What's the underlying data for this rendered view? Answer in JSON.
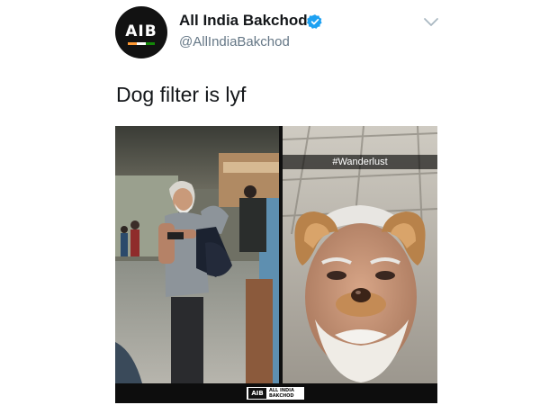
{
  "account": {
    "display_name": "All India Bakchod",
    "handle": "@AllIndiaBakchod",
    "avatar_text": "AIB",
    "verified": true
  },
  "tweet": {
    "text": "Dog filter is lyf"
  },
  "media": {
    "right_caption": "#Wanderlust",
    "brand_logo_text": "AIB",
    "brand_name": "ALL INDIA BAKCHOD"
  },
  "icons": {
    "verified": "verified-badge-icon",
    "menu": "chevron-down-icon"
  },
  "colors": {
    "verified_blue": "#1da1f2",
    "handle_gray": "#657786",
    "text_dark": "#14171a",
    "flag_saffron": "#ff9933",
    "flag_white": "#ffffff",
    "flag_green": "#138808"
  }
}
